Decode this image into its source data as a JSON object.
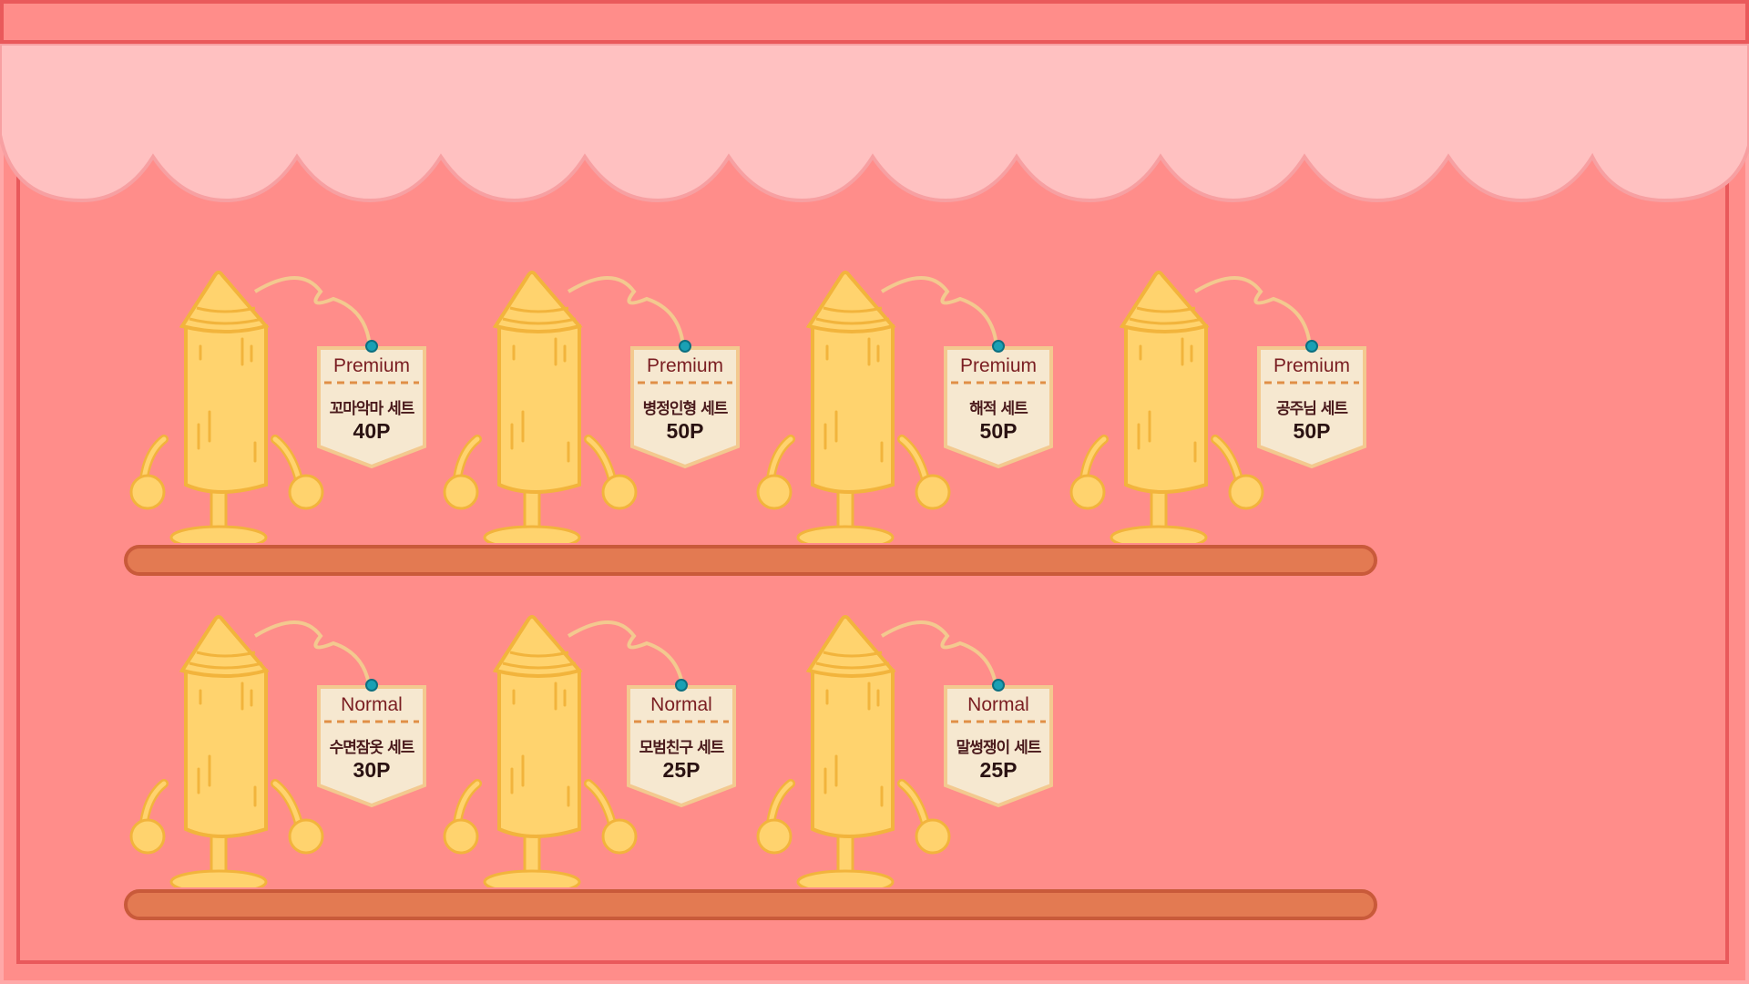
{
  "colors": {
    "background": "#ff8d8a",
    "awning": "#ffc1c1",
    "frame": "#e9595b",
    "shelf": "#e37a52",
    "candle": "#ffd36e",
    "candle_outline": "#f2b43c",
    "tag": "#f6e8d0",
    "pin": "#1aa0b4"
  },
  "shelves": [
    {
      "items": [
        {
          "tier": "Premium",
          "name": "꼬마악마 세트",
          "price": "40P"
        },
        {
          "tier": "Premium",
          "name": "병정인형 세트",
          "price": "50P"
        },
        {
          "tier": "Premium",
          "name": "해적 세트",
          "price": "50P"
        },
        {
          "tier": "Premium",
          "name": "공주님 세트",
          "price": "50P"
        }
      ]
    },
    {
      "items": [
        {
          "tier": "Normal",
          "name": "수면잠옷 세트",
          "price": "30P"
        },
        {
          "tier": "Normal",
          "name": "모범친구 세트",
          "price": "25P"
        },
        {
          "tier": "Normal",
          "name": "말썽쟁이 세트",
          "price": "25P"
        }
      ]
    }
  ]
}
